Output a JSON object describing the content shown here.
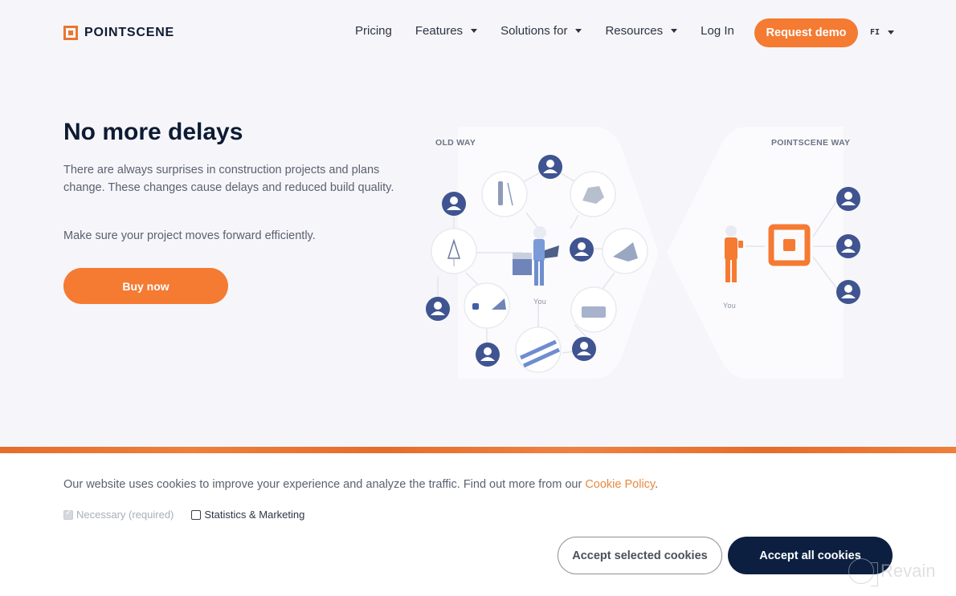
{
  "header": {
    "logo_text": "POINTSCENE",
    "nav": [
      {
        "label": "Pricing",
        "dropdown": false
      },
      {
        "label": "Features",
        "dropdown": true
      },
      {
        "label": "Solutions for",
        "dropdown": true
      },
      {
        "label": "Resources",
        "dropdown": true
      },
      {
        "label": "Log In",
        "dropdown": false
      }
    ],
    "cta_label": "Request demo",
    "language": "FI"
  },
  "hero": {
    "title": "No more delays",
    "paragraph1": "There are always surprises in construction projects and plans change. These changes cause delays and reduced build quality.",
    "paragraph2": "Make sure your project moves forward efficiently.",
    "buy_label": "Buy now"
  },
  "illustration": {
    "old_way_label": "OLD WAY",
    "new_way_label": "POINTSCENE WAY",
    "you_label_old": "You",
    "you_label_new": "You",
    "old_way_nodes": [
      "surveyor",
      "rocks",
      "warning-sign",
      "excavator",
      "laptop-coffee",
      "dump-truck",
      "pipes"
    ],
    "colors": {
      "accent": "#f57a32",
      "avatar": "#3f5490"
    }
  },
  "cookie": {
    "message": "Our website uses cookies to improve your experience and analyze the traffic. Find out more from our ",
    "policy_link": "Cookie Policy",
    "policy_suffix": ".",
    "options": [
      {
        "label": "Necessary (required)",
        "checked": true,
        "disabled": true
      },
      {
        "label": "Statistics & Marketing",
        "checked": false,
        "disabled": false
      }
    ],
    "accept_selected_label": "Accept selected cookies",
    "accept_all_label": "Accept all cookies"
  },
  "watermark": {
    "text": "Revain"
  }
}
